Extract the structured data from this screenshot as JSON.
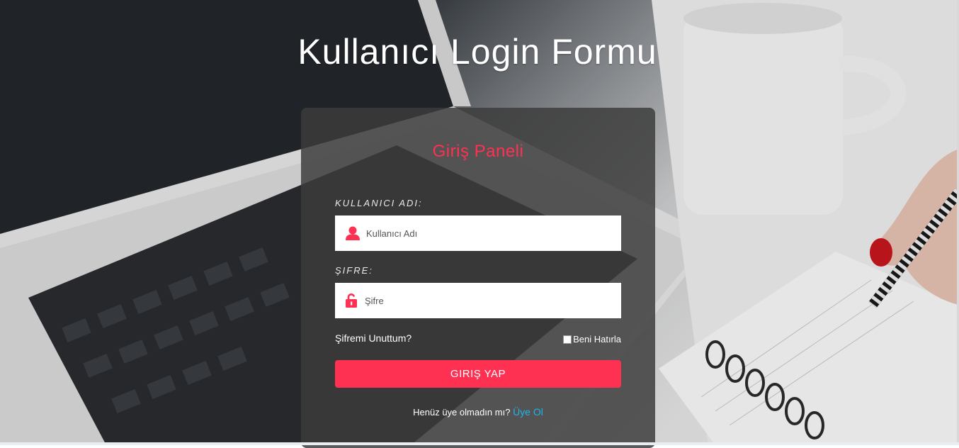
{
  "header": {
    "title": "Kullanıcı Login Formu"
  },
  "panel": {
    "title": "Giriş Paneli",
    "username": {
      "label": "KULLANICI ADI:",
      "placeholder": "Kullanıcı Adı",
      "value": "",
      "icon": "user-icon"
    },
    "password": {
      "label": "ŞIFRE:",
      "placeholder": "Şifre",
      "value": "",
      "icon": "unlock-icon"
    },
    "forgot_password": "Şifremi Unuttum?",
    "remember_me": "Beni Hatırla",
    "login_button": "GIRIŞ YAP",
    "signup_prompt": "Henüz üye olmadın mı?",
    "signup_link": "Üye Ol"
  },
  "colors": {
    "accent": "#ff3152",
    "link": "#1fb6e6",
    "panel": "#3c3c3c",
    "text": "#ffffff"
  }
}
